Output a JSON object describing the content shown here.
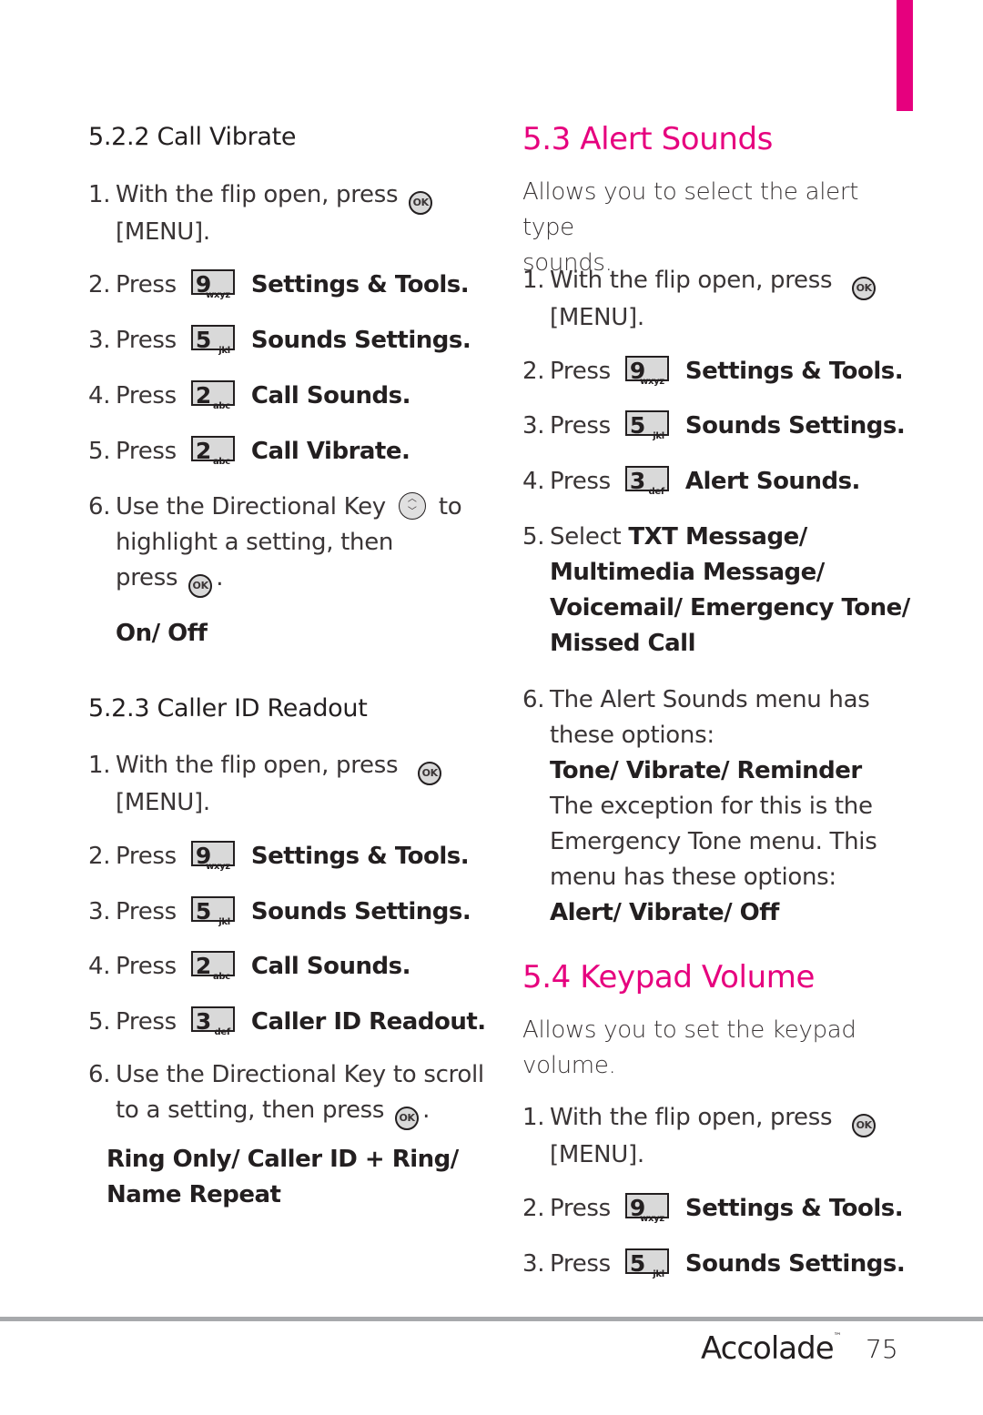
{
  "colors": {
    "accent": "#e6007e",
    "text": "#231f20",
    "rule": "#a7a9ac"
  },
  "left": {
    "call_vibrate": {
      "heading": "5.2.2 Call Vibrate",
      "steps": [
        {
          "num": "1.",
          "text": "With the flip open, press",
          "icon": "ok-key-icon",
          "line2": "[MENU]."
        },
        {
          "num": "2.",
          "prefix": "Press",
          "key_digit": "9",
          "key_letters": "wxyz",
          "label": "Settings & Tools."
        },
        {
          "num": "3.",
          "prefix": "Press",
          "key_digit": "5",
          "key_letters": "jkl",
          "label": "Sounds Settings."
        },
        {
          "num": "4.",
          "prefix": "Press",
          "key_digit": "2",
          "key_letters": "abc",
          "label": "Call Sounds."
        },
        {
          "num": "5.",
          "prefix": "Press",
          "key_digit": "2",
          "key_letters": "abc",
          "label": "Call Vibrate."
        },
        {
          "num": "6.",
          "text": "Use the Directional Key",
          "icon": "directional-key-icon",
          "after": "to",
          "line2": "highlight a setting, then",
          "line3": "press",
          "line3_icon": "ok-key-icon",
          "line3_end": "."
        }
      ],
      "options": "On/ Off"
    },
    "caller_id": {
      "heading": "5.2.3 Caller ID Readout",
      "steps": [
        {
          "num": "1.",
          "text": "With the flip open, press",
          "icon": "ok-key-icon",
          "line2": "[MENU]."
        },
        {
          "num": "2.",
          "prefix": "Press",
          "key_digit": "9",
          "key_letters": "wxyz",
          "label": "Settings & Tools."
        },
        {
          "num": "3.",
          "prefix": "Press",
          "key_digit": "5",
          "key_letters": "jkl",
          "label": "Sounds Settings."
        },
        {
          "num": "4.",
          "prefix": "Press",
          "key_digit": "2",
          "key_letters": "abc",
          "label": "Call Sounds."
        },
        {
          "num": "5.",
          "prefix": "Press",
          "key_digit": "3",
          "key_letters": "def",
          "label": "Caller ID Readout."
        },
        {
          "num": "6.",
          "text": "Use the Directional Key to scroll",
          "line2": "to a setting, then press",
          "line2_icon": "ok-key-icon",
          "line2_end": "."
        }
      ],
      "options_line1": "Ring Only/ Caller ID + Ring/",
      "options_line2": "Name Repeat"
    }
  },
  "right": {
    "alert_sounds": {
      "heading": "5.3 Alert Sounds",
      "intro_line1": "Allows you to select the alert type",
      "intro_line2": "sounds.",
      "steps": [
        {
          "num": "1.",
          "text": "With the flip open, press",
          "icon": "ok-key-icon",
          "line2": "[MENU]."
        },
        {
          "num": "2.",
          "prefix": "Press",
          "key_digit": "9",
          "key_letters": "wxyz",
          "label": "Settings & Tools."
        },
        {
          "num": "3.",
          "prefix": "Press",
          "key_digit": "5",
          "key_letters": "jkl",
          "label": "Sounds Settings."
        },
        {
          "num": "4.",
          "prefix": "Press",
          "key_digit": "3",
          "key_letters": "def",
          "label": "Alert Sounds."
        },
        {
          "num": "5.",
          "prefix": "Select",
          "bold_line1": "TXT Message/",
          "bold_line2": "Multimedia Message/",
          "bold_line3": "Voicemail/ Emergency Tone/",
          "bold_line4": "Missed Call"
        },
        {
          "num": "6.",
          "text": "The Alert Sounds menu has",
          "line2": "these options:",
          "bold_line3": "Tone/ Vibrate/ Reminder",
          "line4": "The exception for this is the",
          "line5": "Emergency Tone menu. This",
          "line6": "menu has these options:",
          "bold_line7": "Alert/ Vibrate/ Off"
        }
      ]
    },
    "keypad_volume": {
      "heading": "5.4 Keypad Volume",
      "intro_line1": "Allows you to set the keypad",
      "intro_line2": "volume.",
      "steps": [
        {
          "num": "1.",
          "text": "With the flip open, press",
          "icon": "ok-key-icon",
          "line2": "[MENU]."
        },
        {
          "num": "2.",
          "prefix": "Press",
          "key_digit": "9",
          "key_letters": "wxyz",
          "label": "Settings & Tools."
        },
        {
          "num": "3.",
          "prefix": "Press",
          "key_digit": "5",
          "key_letters": "jkl",
          "label": "Sounds Settings."
        }
      ]
    }
  },
  "icons": {
    "ok": "OK",
    "up": "︿",
    "down": "﹀"
  },
  "footer": {
    "brand": "Accolade",
    "trademark": "™",
    "page": "75"
  }
}
